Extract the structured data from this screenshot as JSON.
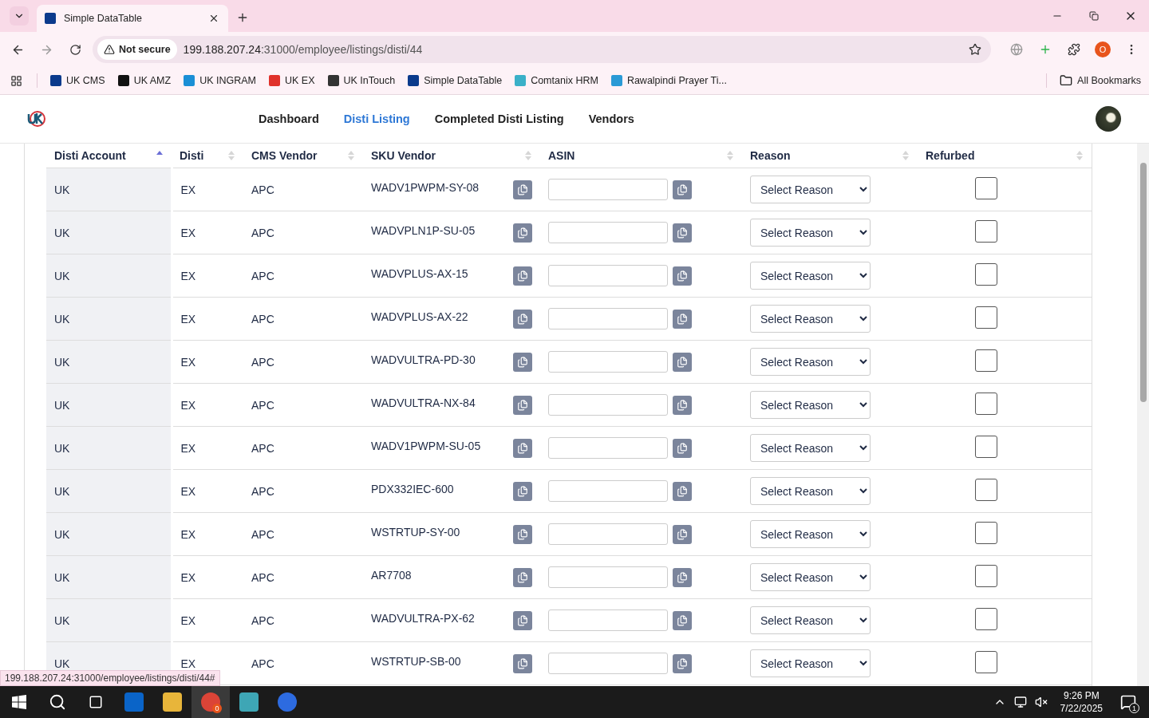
{
  "browser": {
    "tabs": [
      {
        "title": "Simple DataTable",
        "selected": true
      }
    ],
    "security": "Not secure",
    "url_host": "199.188.207.24",
    "url_path": ":31000/employee/listings/disti/44",
    "profile": "O",
    "bookmarks": [
      {
        "label": "UK CMS",
        "color": "#0b3a8c"
      },
      {
        "label": "UK AMZ",
        "color": "#111111"
      },
      {
        "label": "UK INGRAM",
        "color": "#1a8fd6"
      },
      {
        "label": "UK EX",
        "color": "#e0322b"
      },
      {
        "label": "UK InTouch",
        "color": "#333333"
      },
      {
        "label": "Simple DataTable",
        "color": "#0b3a8c"
      },
      {
        "label": "Comtanix HRM",
        "color": "#3ab0c8"
      },
      {
        "label": "Rawalpindi Prayer Ti...",
        "color": "#2a9ad6"
      }
    ],
    "all_bookmarks": "All Bookmarks"
  },
  "nav": {
    "items": [
      {
        "label": "Dashboard",
        "selected": false
      },
      {
        "label": "Disti Listing",
        "selected": true
      },
      {
        "label": "Completed Disti Listing",
        "selected": false
      },
      {
        "label": "Vendors",
        "selected": false
      }
    ]
  },
  "table": {
    "columns": [
      {
        "label": "Disti Account",
        "sorted": true
      },
      {
        "label": "Disti",
        "sorted": false
      },
      {
        "label": "CMS Vendor",
        "sorted": false
      },
      {
        "label": "SKU Vendor",
        "sorted": false
      },
      {
        "label": "ASIN",
        "sorted": false
      },
      {
        "label": "Reason",
        "sorted": false
      },
      {
        "label": "Refurbed",
        "sorted": false
      }
    ],
    "rows": [
      {
        "account": "UK",
        "disti": "EX",
        "vendor": "APC",
        "sku": "WADV1PWPM-SY-08",
        "reason": "Select Reason",
        "refurbed": false
      },
      {
        "account": "UK",
        "disti": "EX",
        "vendor": "APC",
        "sku": "WADVPLN1P-SU-05",
        "reason": "Select Reason",
        "refurbed": false
      },
      {
        "account": "UK",
        "disti": "EX",
        "vendor": "APC",
        "sku": "WADVPLUS-AX-15",
        "reason": "Select Reason",
        "refurbed": false
      },
      {
        "account": "UK",
        "disti": "EX",
        "vendor": "APC",
        "sku": "WADVPLUS-AX-22",
        "reason": "Select Reason",
        "refurbed": false
      },
      {
        "account": "UK",
        "disti": "EX",
        "vendor": "APC",
        "sku": "WADVULTRA-PD-30",
        "reason": "Select Reason",
        "refurbed": false
      },
      {
        "account": "UK",
        "disti": "EX",
        "vendor": "APC",
        "sku": "WADVULTRA-NX-84",
        "reason": "Select Reason",
        "refurbed": false
      },
      {
        "account": "UK",
        "disti": "EX",
        "vendor": "APC",
        "sku": "WADV1PWPM-SU-05",
        "reason": "Select Reason",
        "refurbed": false
      },
      {
        "account": "UK",
        "disti": "EX",
        "vendor": "APC",
        "sku": "PDX332IEC-600",
        "reason": "Select Reason",
        "refurbed": false
      },
      {
        "account": "UK",
        "disti": "EX",
        "vendor": "APC",
        "sku": "WSTRTUP-SY-00",
        "reason": "Select Reason",
        "refurbed": false
      },
      {
        "account": "UK",
        "disti": "EX",
        "vendor": "APC",
        "sku": "AR7708",
        "reason": "Select Reason",
        "refurbed": false
      },
      {
        "account": "UK",
        "disti": "EX",
        "vendor": "APC",
        "sku": "WADVULTRA-PX-62",
        "reason": "Select Reason",
        "refurbed": false
      },
      {
        "account": "UK",
        "disti": "EX",
        "vendor": "APC",
        "sku": "WSTRTUP-SB-00",
        "reason": "Select Reason",
        "refurbed": false
      }
    ]
  },
  "status_url": "199.188.207.24:31000/employee/listings/disti/44#",
  "taskbar": {
    "chrome_badge": "0",
    "time": "9:26 PM",
    "date": "7/22/2025",
    "notifications": "1"
  }
}
